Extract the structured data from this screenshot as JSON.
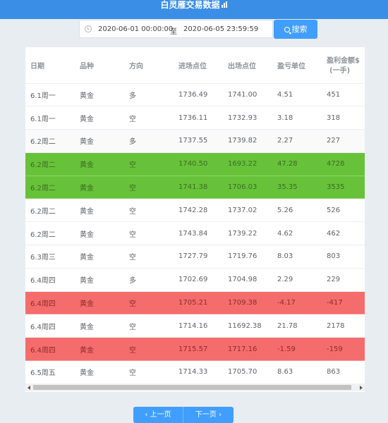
{
  "header": {
    "title": "白灵雁交易数据"
  },
  "filter": {
    "start": "2020-06-01 00:00:00",
    "separator": "至",
    "end": "2020-06-05 23:59:59",
    "search_label": "搜索"
  },
  "table": {
    "columns": [
      "日期",
      "品种",
      "方向",
      "进场点位",
      "出场点位",
      "盈亏单位",
      "盈利金额$"
    ],
    "last_col_sub": "(一手)",
    "rows": [
      {
        "date": "6.1周一",
        "product": "黄金",
        "dir": "多",
        "entry": "1736.49",
        "exit": "1741.00",
        "units": "4.51",
        "profit": "451",
        "hl": ""
      },
      {
        "date": "6.1周一",
        "product": "黄金",
        "dir": "空",
        "entry": "1736.11",
        "exit": "1732.93",
        "units": "3.18",
        "profit": "318",
        "hl": ""
      },
      {
        "date": "6.2周二",
        "product": "黄金",
        "dir": "多",
        "entry": "1737.55",
        "exit": "1739.82",
        "units": "2.27",
        "profit": "227",
        "hl": "alt"
      },
      {
        "date": "6.2周二",
        "product": "黄金",
        "dir": "空",
        "entry": "1740.50",
        "exit": "1693.22",
        "units": "47.28",
        "profit": "4728",
        "hl": "g"
      },
      {
        "date": "6.2周二",
        "product": "黄金",
        "dir": "空",
        "entry": "1741.38",
        "exit": "1706.03",
        "units": "35.35",
        "profit": "3535",
        "hl": "g"
      },
      {
        "date": "6.2周二",
        "product": "黄金",
        "dir": "空",
        "entry": "1742.28",
        "exit": "1737.02",
        "units": "5.26",
        "profit": "526",
        "hl": ""
      },
      {
        "date": "6.2周二",
        "product": "黄金",
        "dir": "空",
        "entry": "1743.84",
        "exit": "1739.22",
        "units": "4.62",
        "profit": "462",
        "hl": ""
      },
      {
        "date": "6.3周三",
        "product": "黄金",
        "dir": "空",
        "entry": "1727.79",
        "exit": "1719.76",
        "units": "8.03",
        "profit": "803",
        "hl": ""
      },
      {
        "date": "6.4周四",
        "product": "黄金",
        "dir": "多",
        "entry": "1702.69",
        "exit": "1704.98",
        "units": "2.29",
        "profit": "229",
        "hl": ""
      },
      {
        "date": "6.4周四",
        "product": "黄金",
        "dir": "空",
        "entry": "1705.21",
        "exit": "1709.38",
        "units": "-4.17",
        "profit": "-417",
        "hl": "r"
      },
      {
        "date": "6.4周四",
        "product": "黄金",
        "dir": "空",
        "entry": "1714.16",
        "exit": "11692.38",
        "units": "21.78",
        "profit": "2178",
        "hl": ""
      },
      {
        "date": "6.4周四",
        "product": "黄金",
        "dir": "空",
        "entry": "1715.57",
        "exit": "1717.16",
        "units": "-1.59",
        "profit": "-159",
        "hl": "r"
      },
      {
        "date": "6.5周五",
        "product": "黄金",
        "dir": "空",
        "entry": "1714.33",
        "exit": "1705.70",
        "units": "8.63",
        "profit": "863",
        "hl": ""
      }
    ]
  },
  "pager": {
    "prev_label": "上一页",
    "next_label": "下一页"
  },
  "colors": {
    "accent": "#409eff",
    "header_bg": "#3a8ee6",
    "profit_highlight": "#67c23a",
    "loss_highlight": "#f56c6c"
  }
}
